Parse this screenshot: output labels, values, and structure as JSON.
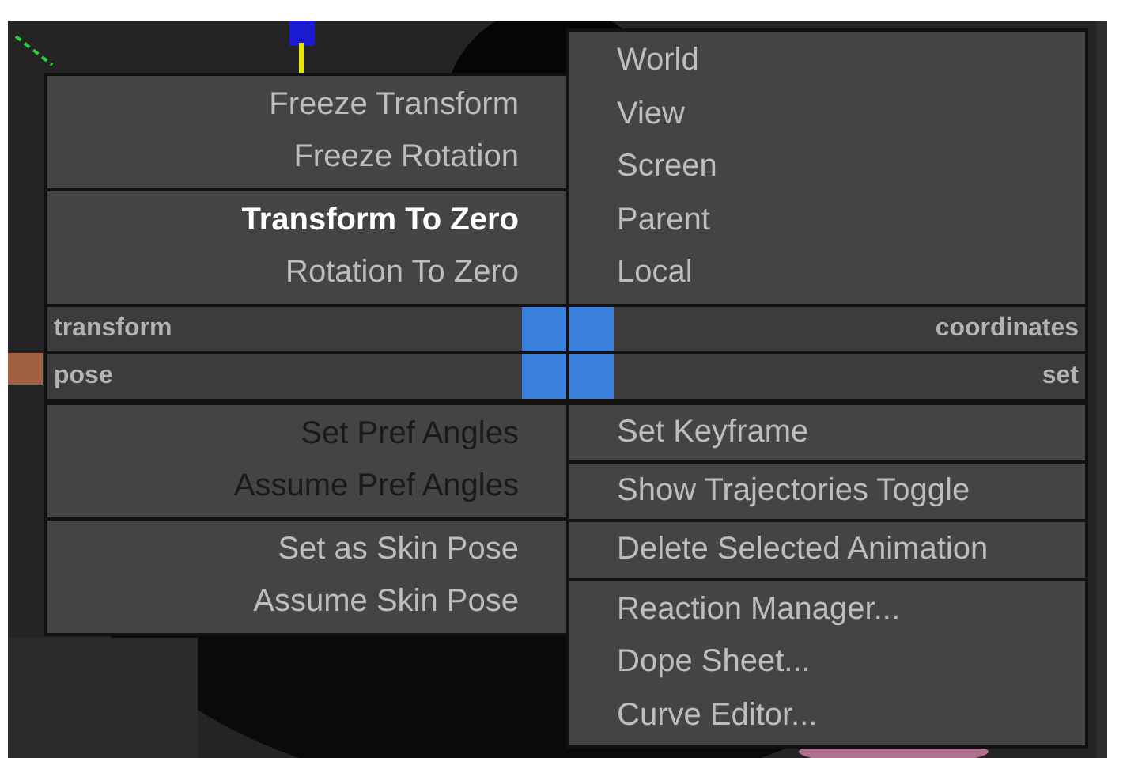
{
  "quad_menu": {
    "top_right": {
      "groups": [
        [
          {
            "label": "World",
            "disabled": false,
            "highlighted": false
          },
          {
            "label": "View",
            "disabled": false,
            "highlighted": false
          },
          {
            "label": "Screen",
            "disabled": false,
            "highlighted": false
          },
          {
            "label": "Parent",
            "disabled": false,
            "highlighted": false
          },
          {
            "label": "Local",
            "disabled": false,
            "highlighted": false
          }
        ]
      ]
    },
    "top_left": {
      "groups": [
        [
          {
            "label": "Freeze Transform",
            "disabled": false,
            "highlighted": false
          },
          {
            "label": "Freeze Rotation",
            "disabled": false,
            "highlighted": false
          }
        ],
        [
          {
            "label": "Transform To Zero",
            "disabled": false,
            "highlighted": true
          },
          {
            "label": "Rotation To Zero",
            "disabled": false,
            "highlighted": false
          }
        ]
      ]
    },
    "titles": [
      {
        "left": "transform",
        "right": "coordinates"
      },
      {
        "left": "pose",
        "right": "set"
      }
    ],
    "bottom_left": {
      "groups": [
        [
          {
            "label": "Set Pref Angles",
            "disabled": true,
            "highlighted": false
          },
          {
            "label": "Assume Pref Angles",
            "disabled": true,
            "highlighted": false
          }
        ],
        [
          {
            "label": "Set as Skin Pose",
            "disabled": false,
            "highlighted": false
          },
          {
            "label": "Assume Skin Pose",
            "disabled": false,
            "highlighted": false
          }
        ]
      ]
    },
    "bottom_right": {
      "groups": [
        [
          {
            "label": "Set Keyframe",
            "disabled": false,
            "highlighted": false
          }
        ],
        [
          {
            "label": "Show Trajectories Toggle",
            "disabled": false,
            "highlighted": false
          }
        ],
        [
          {
            "label": "Delete Selected Animation",
            "disabled": false,
            "highlighted": false
          }
        ],
        [
          {
            "label": "Reaction Manager...",
            "disabled": false,
            "highlighted": false
          },
          {
            "label": "Dope Sheet...",
            "disabled": false,
            "highlighted": false
          },
          {
            "label": "Curve Editor...",
            "disabled": false,
            "highlighted": false
          }
        ]
      ]
    }
  }
}
